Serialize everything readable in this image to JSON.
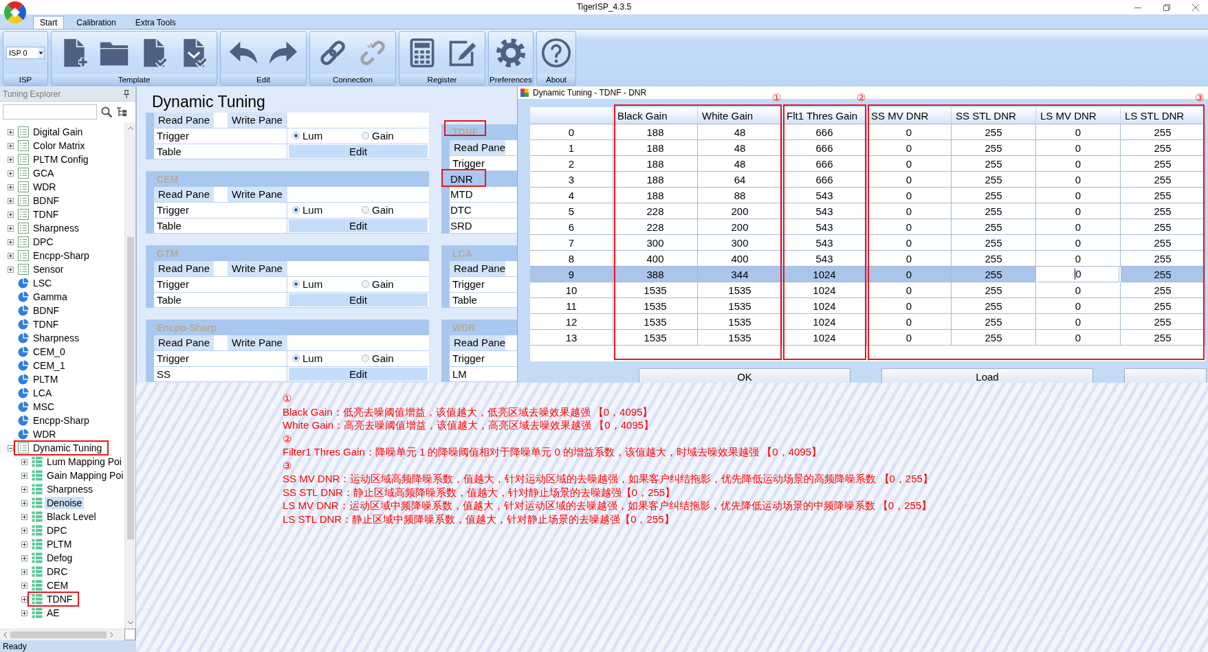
{
  "window": {
    "title": "TigerISP_4.3.5"
  },
  "ribbon_tabs": [
    {
      "label": "Start",
      "selected": true
    },
    {
      "label": "Calibration",
      "selected": false
    },
    {
      "label": "Extra Tools",
      "selected": false
    }
  ],
  "ribbon_groups": [
    {
      "kind": "dropdown",
      "label": "ISP",
      "value": "ISP 0"
    },
    {
      "kind": "tools",
      "label": "Template",
      "buttons": [
        {
          "disabled": false
        },
        {
          "disabled": false
        },
        {
          "disabled": false
        },
        {
          "disabled": false
        }
      ]
    },
    {
      "kind": "tools",
      "label": "Edit",
      "buttons": [
        {
          "disabled": false
        },
        {
          "disabled": false
        }
      ]
    },
    {
      "kind": "tools",
      "label": "Connection",
      "buttons": [
        {
          "disabled": false
        },
        {
          "disabled": true
        }
      ]
    },
    {
      "kind": "tools",
      "label": "Register",
      "buttons": [
        {
          "disabled": false
        },
        {
          "disabled": false
        }
      ]
    },
    {
      "kind": "tools",
      "label": "Preferences",
      "buttons": [
        {
          "disabled": false
        }
      ]
    },
    {
      "kind": "tools",
      "label": "About",
      "buttons": [
        {
          "disabled": false
        }
      ]
    }
  ],
  "explorer": {
    "title": "Tuning Explorer",
    "tree": [
      {
        "label": "Digital Gain",
        "kind": "table",
        "expanded": false,
        "selected": false,
        "marked": false
      },
      {
        "label": "Color Matrix",
        "kind": "table",
        "expanded": false,
        "selected": false,
        "marked": false
      },
      {
        "label": "PLTM Config",
        "kind": "table",
        "expanded": false,
        "selected": false,
        "marked": false
      },
      {
        "label": "GCA",
        "kind": "table",
        "expanded": false,
        "selected": false,
        "marked": false
      },
      {
        "label": "WDR",
        "kind": "table",
        "expanded": false,
        "selected": false,
        "marked": false
      },
      {
        "label": "BDNF",
        "kind": "table",
        "expanded": false,
        "selected": false,
        "marked": false
      },
      {
        "label": "TDNF",
        "kind": "table",
        "expanded": false,
        "selected": false,
        "marked": false
      },
      {
        "label": "Sharpness",
        "kind": "table",
        "expanded": false,
        "selected": false,
        "marked": false
      },
      {
        "label": "DPC",
        "kind": "table",
        "expanded": false,
        "selected": false,
        "marked": false
      },
      {
        "label": "Encpp-Sharp",
        "kind": "table",
        "expanded": false,
        "selected": false,
        "marked": false
      },
      {
        "label": "Sensor",
        "kind": "table",
        "expanded": false,
        "selected": false,
        "marked": false
      },
      {
        "label": "LSC",
        "kind": "curve",
        "expanded": false,
        "selected": false,
        "marked": false
      },
      {
        "label": "Gamma",
        "kind": "curve",
        "expanded": false,
        "selected": false,
        "marked": false
      },
      {
        "label": "BDNF",
        "kind": "curve",
        "expanded": false,
        "selected": false,
        "marked": false
      },
      {
        "label": "TDNF",
        "kind": "curve",
        "expanded": false,
        "selected": false,
        "marked": false
      },
      {
        "label": "Sharpness",
        "kind": "curve",
        "expanded": false,
        "selected": false,
        "marked": false
      },
      {
        "label": "CEM_0",
        "kind": "curve",
        "expanded": false,
        "selected": false,
        "marked": false
      },
      {
        "label": "CEM_1",
        "kind": "curve",
        "expanded": false,
        "selected": false,
        "marked": false
      },
      {
        "label": "PLTM",
        "kind": "curve",
        "expanded": false,
        "selected": false,
        "marked": false
      },
      {
        "label": "LCA",
        "kind": "curve",
        "expanded": false,
        "selected": false,
        "marked": false
      },
      {
        "label": "MSC",
        "kind": "curve",
        "expanded": false,
        "selected": false,
        "marked": false
      },
      {
        "label": "Encpp-Sharp",
        "kind": "curve",
        "expanded": false,
        "selected": false,
        "marked": false
      },
      {
        "label": "WDR",
        "kind": "curve",
        "expanded": false,
        "selected": false,
        "marked": false
      },
      {
        "label": "Dynamic Tuning",
        "kind": "table",
        "expanded": true,
        "selected": false,
        "marked": true,
        "children": [
          {
            "label": "Lum Mapping Poi",
            "kind": "grid",
            "expanded": false,
            "selected": false,
            "marked": false
          },
          {
            "label": "Gain Mapping Poi",
            "kind": "grid",
            "expanded": false,
            "selected": false,
            "marked": false
          },
          {
            "label": "Sharpness",
            "kind": "grid",
            "expanded": false,
            "selected": false,
            "marked": false
          },
          {
            "label": "Denoise",
            "kind": "grid",
            "expanded": false,
            "selected": true,
            "marked": false
          },
          {
            "label": "Black Level",
            "kind": "grid",
            "expanded": false,
            "selected": false,
            "marked": false
          },
          {
            "label": "DPC",
            "kind": "grid",
            "expanded": false,
            "selected": false,
            "marked": false
          },
          {
            "label": "PLTM",
            "kind": "grid",
            "expanded": false,
            "selected": false,
            "marked": false
          },
          {
            "label": "Defog",
            "kind": "grid",
            "expanded": false,
            "selected": false,
            "marked": false
          },
          {
            "label": "DRC",
            "kind": "grid",
            "expanded": false,
            "selected": false,
            "marked": false
          },
          {
            "label": "CEM",
            "kind": "grid",
            "expanded": false,
            "selected": false,
            "marked": false
          },
          {
            "label": "TDNF",
            "kind": "grid",
            "expanded": false,
            "selected": false,
            "marked": true
          },
          {
            "label": "AE",
            "kind": "grid",
            "expanded": false,
            "selected": false,
            "marked": false
          }
        ]
      }
    ]
  },
  "content": {
    "title": "Dynamic Tuning",
    "left_sections": [
      {
        "panes": [
          "Read Pane",
          "Write Pane"
        ],
        "rows": [
          {
            "kind": "radio",
            "label": "Trigger",
            "options": [
              {
                "label": "Lum",
                "selected": true
              },
              {
                "label": "Gain",
                "selected": false
              }
            ]
          },
          {
            "kind": "button",
            "label": "Table",
            "button": "Edit"
          }
        ]
      },
      {
        "title": "CEM",
        "panes": [
          "Read Pane",
          "Write Pane"
        ],
        "rows": [
          {
            "kind": "radio",
            "label": "Trigger",
            "options": [
              {
                "label": "Lum",
                "selected": true
              },
              {
                "label": "Gain",
                "selected": false
              }
            ]
          },
          {
            "kind": "button",
            "label": "Table",
            "button": "Edit"
          }
        ]
      },
      {
        "title": "GTM",
        "panes": [
          "Read Pane",
          "Write Pane"
        ],
        "rows": [
          {
            "kind": "radio",
            "label": "Trigger",
            "options": [
              {
                "label": "Lum",
                "selected": true
              },
              {
                "label": "Gain",
                "selected": false
              }
            ]
          },
          {
            "kind": "button",
            "label": "Table",
            "button": "Edit"
          }
        ]
      },
      {
        "title": "Encpp-Sharp",
        "panes": [
          "Read Pane",
          "Write Pane"
        ],
        "rows": [
          {
            "kind": "radio",
            "label": "Trigger",
            "options": [
              {
                "label": "Lum",
                "selected": true
              },
              {
                "label": "Gain",
                "selected": false
              }
            ]
          },
          {
            "kind": "button",
            "label": "SS",
            "button": "Edit"
          }
        ]
      }
    ],
    "right_sections": [
      {
        "title": "TDNF",
        "marked": true,
        "panes": [
          "Read Pane"
        ],
        "rows": [
          {
            "kind": "radio",
            "label": "Trigger",
            "selected": false,
            "marked": false
          },
          {
            "kind": "item",
            "label": "DNR",
            "selected": true,
            "marked": true
          },
          {
            "kind": "item",
            "label": "MTD",
            "selected": false,
            "marked": false
          },
          {
            "kind": "item",
            "label": "DTC",
            "selected": false,
            "marked": false
          },
          {
            "kind": "item",
            "label": "SRD",
            "selected": false,
            "marked": false
          }
        ]
      },
      {
        "title": "LCA",
        "marked": false,
        "panes": [
          "Read Pane"
        ],
        "rows": [
          {
            "kind": "radio",
            "label": "Trigger"
          },
          {
            "kind": "button",
            "label": "Table"
          }
        ]
      },
      {
        "title": "WDR",
        "marked": false,
        "panes": [
          "Read Pane"
        ],
        "rows": [
          {
            "kind": "radio",
            "label": "Trigger"
          },
          {
            "kind": "button",
            "label": "LM"
          }
        ]
      }
    ]
  },
  "dialog": {
    "title": "Dynamic Tuning - TDNF - DNR",
    "table": {
      "column_groups": [
        {
          "callout": "①",
          "columns": [
            "Black Gain",
            "White Gain"
          ]
        },
        {
          "callout": "②",
          "columns": [
            "Flt1 Thres Gain"
          ]
        },
        {
          "callout": "③",
          "columns": [
            "SS MV DNR",
            "SS STL DNR",
            "LS MV DNR",
            "LS STL DNR"
          ]
        }
      ],
      "rows": [
        {
          "label": "0",
          "selected": false,
          "cells": [
            {
              "value": "188",
              "editing": false
            },
            {
              "value": "48",
              "editing": false
            },
            {
              "value": "666",
              "editing": false
            },
            {
              "value": "0",
              "editing": false
            },
            {
              "value": "255",
              "editing": false
            },
            {
              "value": "0",
              "editing": false
            },
            {
              "value": "255",
              "editing": false
            }
          ]
        },
        {
          "label": "1",
          "selected": false,
          "cells": [
            {
              "value": "188",
              "editing": false
            },
            {
              "value": "48",
              "editing": false
            },
            {
              "value": "666",
              "editing": false
            },
            {
              "value": "0",
              "editing": false
            },
            {
              "value": "255",
              "editing": false
            },
            {
              "value": "0",
              "editing": false
            },
            {
              "value": "255",
              "editing": false
            }
          ]
        },
        {
          "label": "2",
          "selected": false,
          "cells": [
            {
              "value": "188",
              "editing": false
            },
            {
              "value": "48",
              "editing": false
            },
            {
              "value": "666",
              "editing": false
            },
            {
              "value": "0",
              "editing": false
            },
            {
              "value": "255",
              "editing": false
            },
            {
              "value": "0",
              "editing": false
            },
            {
              "value": "255",
              "editing": false
            }
          ]
        },
        {
          "label": "3",
          "selected": false,
          "cells": [
            {
              "value": "188",
              "editing": false
            },
            {
              "value": "64",
              "editing": false
            },
            {
              "value": "666",
              "editing": false
            },
            {
              "value": "0",
              "editing": false
            },
            {
              "value": "255",
              "editing": false
            },
            {
              "value": "0",
              "editing": false
            },
            {
              "value": "255",
              "editing": false
            }
          ]
        },
        {
          "label": "4",
          "selected": false,
          "cells": [
            {
              "value": "188",
              "editing": false
            },
            {
              "value": "88",
              "editing": false
            },
            {
              "value": "543",
              "editing": false
            },
            {
              "value": "0",
              "editing": false
            },
            {
              "value": "255",
              "editing": false
            },
            {
              "value": "0",
              "editing": false
            },
            {
              "value": "255",
              "editing": false
            }
          ]
        },
        {
          "label": "5",
          "selected": false,
          "cells": [
            {
              "value": "228",
              "editing": false
            },
            {
              "value": "200",
              "editing": false
            },
            {
              "value": "543",
              "editing": false
            },
            {
              "value": "0",
              "editing": false
            },
            {
              "value": "255",
              "editing": false
            },
            {
              "value": "0",
              "editing": false
            },
            {
              "value": "255",
              "editing": false
            }
          ]
        },
        {
          "label": "6",
          "selected": false,
          "cells": [
            {
              "value": "228",
              "editing": false
            },
            {
              "value": "200",
              "editing": false
            },
            {
              "value": "543",
              "editing": false
            },
            {
              "value": "0",
              "editing": false
            },
            {
              "value": "255",
              "editing": false
            },
            {
              "value": "0",
              "editing": false
            },
            {
              "value": "255",
              "editing": false
            }
          ]
        },
        {
          "label": "7",
          "selected": false,
          "cells": [
            {
              "value": "300",
              "editing": false
            },
            {
              "value": "300",
              "editing": false
            },
            {
              "value": "543",
              "editing": false
            },
            {
              "value": "0",
              "editing": false
            },
            {
              "value": "255",
              "editing": false
            },
            {
              "value": "0",
              "editing": false
            },
            {
              "value": "255",
              "editing": false
            }
          ]
        },
        {
          "label": "8",
          "selected": false,
          "cells": [
            {
              "value": "400",
              "editing": false
            },
            {
              "value": "400",
              "editing": false
            },
            {
              "value": "543",
              "editing": false
            },
            {
              "value": "0",
              "editing": false
            },
            {
              "value": "255",
              "editing": false
            },
            {
              "value": "0",
              "editing": false
            },
            {
              "value": "255",
              "editing": false
            }
          ]
        },
        {
          "label": "9",
          "selected": true,
          "cells": [
            {
              "value": "388",
              "editing": false
            },
            {
              "value": "344",
              "editing": false
            },
            {
              "value": "1024",
              "editing": false
            },
            {
              "value": "0",
              "editing": false
            },
            {
              "value": "255",
              "editing": false
            },
            {
              "value": "0",
              "editing": true
            },
            {
              "value": "255",
              "editing": false
            }
          ]
        },
        {
          "label": "10",
          "selected": false,
          "cells": [
            {
              "value": "1535",
              "editing": false
            },
            {
              "value": "1535",
              "editing": false
            },
            {
              "value": "1024",
              "editing": false
            },
            {
              "value": "0",
              "editing": false
            },
            {
              "value": "255",
              "editing": false
            },
            {
              "value": "0",
              "editing": false
            },
            {
              "value": "255",
              "editing": false
            }
          ]
        },
        {
          "label": "11",
          "selected": false,
          "cells": [
            {
              "value": "1535",
              "editing": false
            },
            {
              "value": "1535",
              "editing": false
            },
            {
              "value": "1024",
              "editing": false
            },
            {
              "value": "0",
              "editing": false
            },
            {
              "value": "255",
              "editing": false
            },
            {
              "value": "0",
              "editing": false
            },
            {
              "value": "255",
              "editing": false
            }
          ]
        },
        {
          "label": "12",
          "selected": false,
          "cells": [
            {
              "value": "1535",
              "editing": false
            },
            {
              "value": "1535",
              "editing": false
            },
            {
              "value": "1024",
              "editing": false
            },
            {
              "value": "0",
              "editing": false
            },
            {
              "value": "255",
              "editing": false
            },
            {
              "value": "0",
              "editing": false
            },
            {
              "value": "255",
              "editing": false
            }
          ]
        },
        {
          "label": "13",
          "selected": false,
          "cells": [
            {
              "value": "1535",
              "editing": false
            },
            {
              "value": "1535",
              "editing": false
            },
            {
              "value": "1024",
              "editing": false
            },
            {
              "value": "0",
              "editing": false
            },
            {
              "value": "255",
              "editing": false
            },
            {
              "value": "0",
              "editing": false
            },
            {
              "value": "255",
              "editing": false
            }
          ]
        }
      ]
    },
    "buttons": [
      "OK",
      "Load"
    ]
  },
  "notes": [
    "①",
    "Black Gain：低亮去噪阈值增益，该值越大，低亮区域去噪效果越强 【0，4095】",
    "White Gain：高亮去噪阈值增益，该值越大，高亮区域去噪效果越强 【0，4095】",
    "②",
    "Filter1 Thres Gain：降噪单元 1 的降噪阈值相对于降噪单元 0 的增益系数，该值越大，时域去噪效果越强 【0，4095】",
    "③",
    "SS MV DNR：运动区域高频降噪系数，值越大，针对运动区域的去噪越强，如果客户纠结拖影，优先降低运动场景的高频降噪系数 【0，255】",
    "SS STL DNR：静止区域高频降噪系数，值越大，针对静止场景的去噪越强【0，255】",
    "LS MV DNR：运动区域中频降噪系数，值越大，针对运动区域的去噪越强，如果客户纠结拖影，优先降低运动场景的中频降噪系数 【0，255】",
    "LS STL DNR：静止区域中频降噪系数，值越大，针对静止场景的去噪越强【0，255】"
  ],
  "status_bar": {
    "text": "Ready"
  }
}
